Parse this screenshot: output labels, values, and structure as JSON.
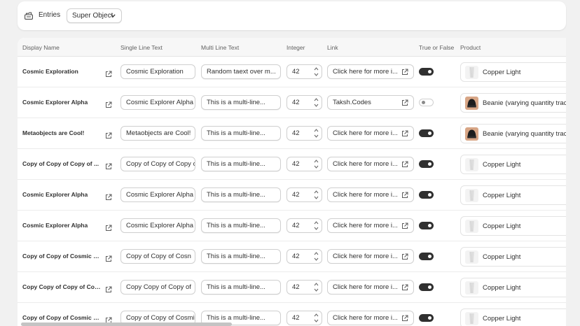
{
  "topbar": {
    "entries_label": "Entries",
    "dropdown_label": "Super Object"
  },
  "headers": [
    "Display Name",
    "Single Line Text",
    "Multi Line Text",
    "Integer",
    "Link",
    "True or False",
    "Product"
  ],
  "rows": [
    {
      "name": "Cosmic Exploration",
      "single": "Cosmic Exploration",
      "multi": "Random taext over m...",
      "integer": "42",
      "link": "Click here for more i...",
      "toggle": true,
      "product": "Copper Light",
      "thumb": "lamp"
    },
    {
      "name": "Cosmic Explorer Alpha",
      "single": "Cosmic Explorer Alpha",
      "multi": "This is a multi-line...",
      "integer": "42",
      "link": "Taksh.Codes",
      "toggle": false,
      "product": "Beanie (varying quantity trac",
      "thumb": "beanie"
    },
    {
      "name": "Metaobjects are Cool!",
      "single": "Metaobjects are Cool!",
      "multi": "This is a multi-line...",
      "integer": "42",
      "link": "Click here for more i...",
      "toggle": true,
      "product": "Beanie (varying quantity trac",
      "thumb": "beanie"
    },
    {
      "name": "Copy of Copy of Copy of ...",
      "single": "Copy of Copy of Copy c",
      "multi": "This is a multi-line...",
      "integer": "42",
      "link": "Click here for more i...",
      "toggle": true,
      "product": "Copper Light",
      "thumb": "lamp"
    },
    {
      "name": "Cosmic Explorer Alpha",
      "single": "Cosmic Explorer Alpha",
      "multi": "This is a multi-line...",
      "integer": "42",
      "link": "Click here for more i...",
      "toggle": true,
      "product": "Copper Light",
      "thumb": "lamp"
    },
    {
      "name": "Cosmic Explorer Alpha",
      "single": "Cosmic Explorer Alpha",
      "multi": "This is a multi-line...",
      "integer": "42",
      "link": "Click here for more i...",
      "toggle": true,
      "product": "Copper Light",
      "thumb": "lamp"
    },
    {
      "name": "Copy of Copy of Cosmic E...",
      "single": "Copy of Copy of Cosn",
      "multi": "This is a multi-line...",
      "integer": "42",
      "link": "Click here for more i...",
      "toggle": true,
      "product": "Copper Light",
      "thumb": "lamp"
    },
    {
      "name": "Copy Copy of Copy of Cos...",
      "single": "Copy Copy of Copy of",
      "multi": "This is a multi-line...",
      "integer": "42",
      "link": "Click here for more i...",
      "toggle": true,
      "product": "Copper Light",
      "thumb": "lamp"
    },
    {
      "name": "Copy of Copy of Cosmic E...",
      "single": "Copy of Copy of Cosmi",
      "multi": "This is a multi-line...",
      "integer": "42",
      "link": "Click here for more i...",
      "toggle": true,
      "product": "Copper Light",
      "thumb": "lamp"
    }
  ]
}
